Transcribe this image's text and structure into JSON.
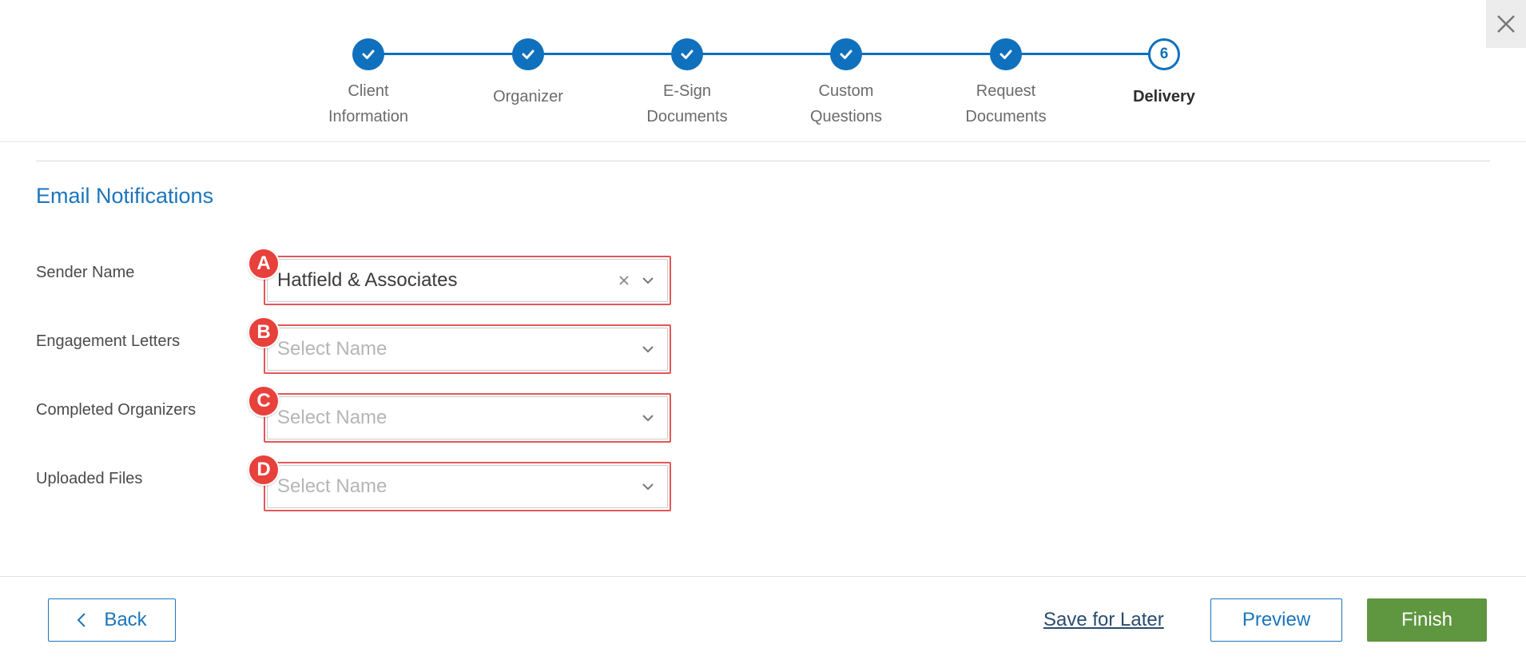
{
  "stepper": {
    "steps": [
      {
        "label": "Client\nInformation",
        "state": "complete"
      },
      {
        "label": "Organizer",
        "state": "complete"
      },
      {
        "label": "E-Sign\nDocuments",
        "state": "complete"
      },
      {
        "label": "Custom\nQuestions",
        "state": "complete"
      },
      {
        "label": "Request\nDocuments",
        "state": "complete"
      },
      {
        "label": "Delivery",
        "state": "current",
        "number": "6"
      }
    ]
  },
  "section": {
    "title": "Email Notifications"
  },
  "fields": [
    {
      "label": "Sender Name",
      "value": "Hatfield & Associates",
      "placeholder": "",
      "badge": "A"
    },
    {
      "label": "Engagement Letters",
      "value": "",
      "placeholder": "Select Name",
      "badge": "B"
    },
    {
      "label": "Completed Organizers",
      "value": "",
      "placeholder": "Select Name",
      "badge": "C"
    },
    {
      "label": "Uploaded Files",
      "value": "",
      "placeholder": "Select Name",
      "badge": "D"
    }
  ],
  "footer": {
    "back_label": "Back",
    "save_label": "Save for Later",
    "preview_label": "Preview",
    "finish_label": "Finish"
  },
  "colors": {
    "primary": "#0f70bd",
    "finish": "#5f9640",
    "highlight": "#e45757",
    "badge": "#e8403b"
  }
}
